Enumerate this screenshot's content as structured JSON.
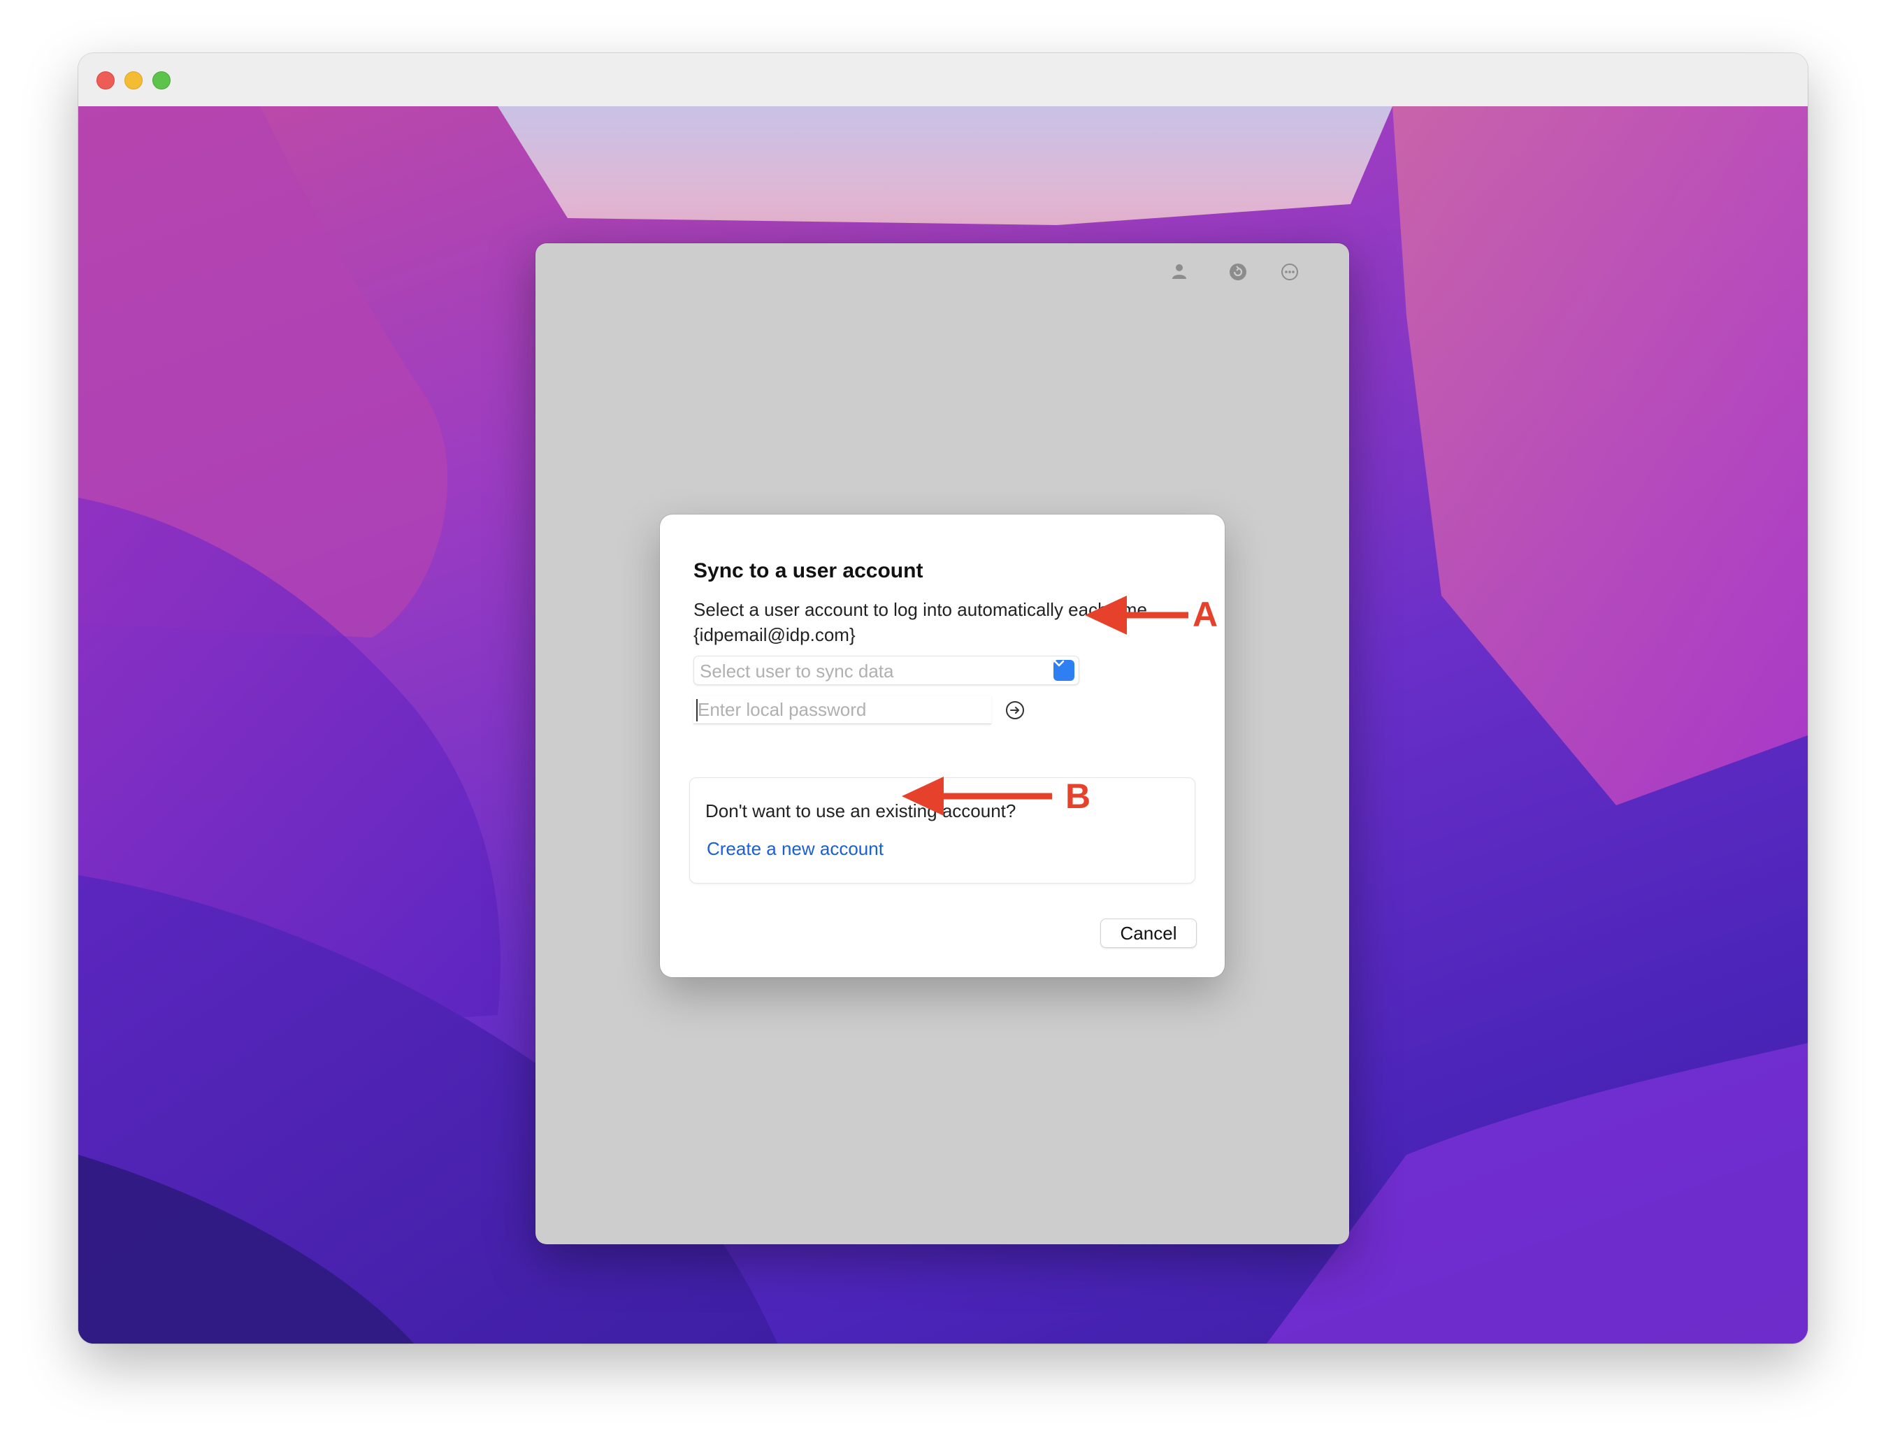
{
  "window": {
    "traffic_lights": [
      "close",
      "minimize",
      "zoom"
    ]
  },
  "panel": {
    "icons": [
      "person-icon",
      "refresh-icon",
      "more-icon"
    ]
  },
  "dialog": {
    "title": "Sync to a user account",
    "description": "Select a user account to log into automatically each time {idpemail@idp.com}",
    "select": {
      "placeholder": "Select user to sync data"
    },
    "password": {
      "placeholder": "Enter local password"
    },
    "alternative": {
      "question": "Don't want to use an existing account?",
      "link": "Create a new account"
    },
    "cancel_label": "Cancel"
  },
  "annotations": {
    "a_label": "A",
    "b_label": "B",
    "color": "#e5412b"
  },
  "colors": {
    "accent": "#2e7ff1",
    "link": "#1b5fd6"
  }
}
